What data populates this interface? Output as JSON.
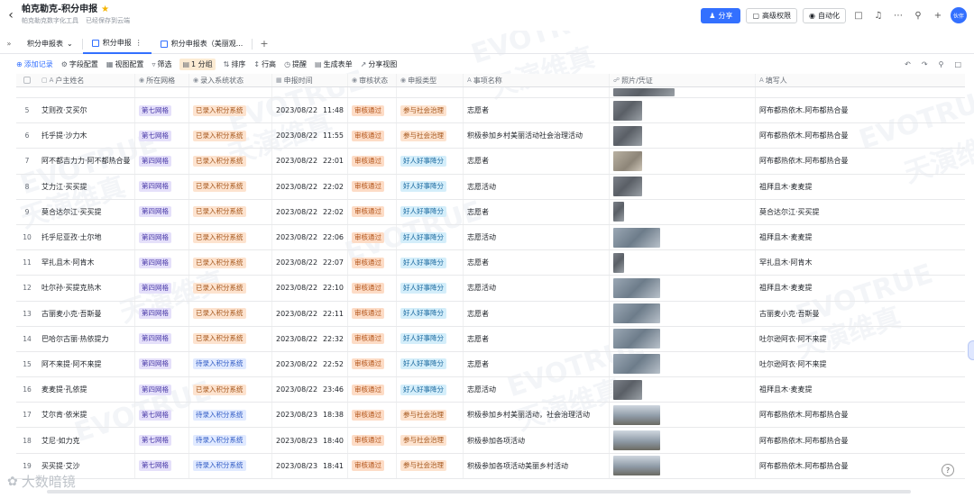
{
  "header": {
    "title": "帕克勒克-积分申报",
    "org": "帕克勒克数字化工具",
    "save_status": "已经保存到云端",
    "share_label": "分享",
    "advanced_perm_label": "高级权限",
    "automation_label": "自动化",
    "avatar_text": "伙伴"
  },
  "tabs": [
    {
      "label": "积分申报表"
    },
    {
      "label": "积分申报"
    },
    {
      "label": "积分申报表（美丽观..."
    }
  ],
  "toolbar": {
    "add_record": "添加记录",
    "field_config": "字段配置",
    "view_config": "视图配置",
    "filter": "筛选",
    "group": "1 分组",
    "sort": "排序",
    "row_height": "行高",
    "remind": "提醒",
    "gen_form": "生成表单",
    "share_view": "分享视图"
  },
  "columns": {
    "name": "户主姓名",
    "grid": "所在网格",
    "sys": "录入系统状态",
    "time": "申报时间",
    "review": "审核状态",
    "type": "申报类型",
    "item": "事项名称",
    "photo": "照片/凭证",
    "filler": "填写人"
  },
  "rows": [
    {
      "idx": "5",
      "name": "艾则孜·艾买尔",
      "grid": "第七网格",
      "sys": "已录入积分系统",
      "date": "2023/08/22",
      "hm": "11:48",
      "review": "审核通过",
      "type": "参与社会治理",
      "item": "志愿者",
      "filler": "阿布都热依木.阿布都热合曼"
    },
    {
      "idx": "6",
      "name": "托乎提·沙力木",
      "grid": "第七网格",
      "sys": "已录入积分系统",
      "date": "2023/08/22",
      "hm": "11:55",
      "review": "审核通过",
      "type": "参与社会治理",
      "item": "积极参加乡村美丽活动社会治理活动",
      "filler": "阿布都热依木.阿布都热合曼"
    },
    {
      "idx": "7",
      "name": "阿不都吉力力·阿不都热合曼",
      "grid": "第四网格",
      "sys": "已录入积分系统",
      "date": "2023/08/22",
      "hm": "22:01",
      "review": "审核通过",
      "type": "好人好事降分",
      "item": "志愿者",
      "filler": "阿布都热依木.阿布都热合曼"
    },
    {
      "idx": "8",
      "name": "艾力江·买买提",
      "grid": "第四网格",
      "sys": "已录入积分系统",
      "date": "2023/08/22",
      "hm": "22:02",
      "review": "审核通过",
      "type": "好人好事降分",
      "item": "志愿活动",
      "filler": "祖拜且木·麦麦提"
    },
    {
      "idx": "9",
      "name": "莫合达尔江·买买提",
      "grid": "第四网格",
      "sys": "已录入积分系统",
      "date": "2023/08/22",
      "hm": "22:02",
      "review": "审核通过",
      "type": "好人好事降分",
      "item": "志愿者",
      "filler": "莫合达尔江·买买提"
    },
    {
      "idx": "10",
      "name": "托乎尼亚孜·土尔地",
      "grid": "第四网格",
      "sys": "已录入积分系统",
      "date": "2023/08/22",
      "hm": "22:06",
      "review": "审核通过",
      "type": "好人好事降分",
      "item": "志愿活动",
      "filler": "祖拜且木·麦麦提"
    },
    {
      "idx": "11",
      "name": "罕扎且木·阿肯木",
      "grid": "第四网格",
      "sys": "已录入积分系统",
      "date": "2023/08/22",
      "hm": "22:07",
      "review": "审核通过",
      "type": "好人好事降分",
      "item": "志愿者",
      "filler": "罕扎且木·阿肯木"
    },
    {
      "idx": "12",
      "name": "吐尔孙·买提克热木",
      "grid": "第四网格",
      "sys": "已录入积分系统",
      "date": "2023/08/22",
      "hm": "22:10",
      "review": "审核通过",
      "type": "好人好事降分",
      "item": "志愿活动",
      "filler": "祖拜且木·麦麦提"
    },
    {
      "idx": "13",
      "name": "古丽麦小克·吾斯曼",
      "grid": "第四网格",
      "sys": "已录入积分系统",
      "date": "2023/08/22",
      "hm": "22:11",
      "review": "审核通过",
      "type": "好人好事降分",
      "item": "志愿者",
      "filler": "古丽麦小克·吾斯曼"
    },
    {
      "idx": "14",
      "name": "巴哈尔古丽·热依提力",
      "grid": "第四网格",
      "sys": "已录入积分系统",
      "date": "2023/08/22",
      "hm": "22:32",
      "review": "审核通过",
      "type": "好人好事降分",
      "item": "志愿者",
      "filler": "吐尔逊阿衣·阿不来提"
    },
    {
      "idx": "15",
      "name": "阿不来提·阿不来提",
      "grid": "第四网格",
      "sys": "待录入积分系统",
      "date": "2023/08/22",
      "hm": "22:52",
      "review": "审核通过",
      "type": "好人好事降分",
      "item": "志愿者",
      "filler": "吐尔逊阿衣·阿不来提"
    },
    {
      "idx": "16",
      "name": "麦麦提·孔依提",
      "grid": "第四网格",
      "sys": "已录入积分系统",
      "date": "2023/08/22",
      "hm": "23:46",
      "review": "审核通过",
      "type": "好人好事降分",
      "item": "志愿活动",
      "filler": "祖拜且木·麦麦提"
    },
    {
      "idx": "17",
      "name": "艾尔肯·依米提",
      "grid": "第七网格",
      "sys": "待录入积分系统",
      "date": "2023/08/23",
      "hm": "18:38",
      "review": "审核通过",
      "type": "参与社会治理",
      "item": "积极参加乡村美丽活动，社会治理活动",
      "filler": "阿布都热依木.阿布都热合曼"
    },
    {
      "idx": "18",
      "name": "艾尼·如力克",
      "grid": "第七网格",
      "sys": "待录入积分系统",
      "date": "2023/08/23",
      "hm": "18:40",
      "review": "审核通过",
      "type": "参与社会治理",
      "item": "积极参加各项活动",
      "filler": "阿布都热依木.阿布都热合曼"
    },
    {
      "idx": "19",
      "name": "买买提·艾沙",
      "grid": "第七网格",
      "sys": "待录入积分系统",
      "date": "2023/08/23",
      "hm": "18:41",
      "review": "审核通过",
      "type": "参与社会治理",
      "item": "积极参加各项活动美丽乡村活动",
      "filler": "阿布都热依木.阿布都热合曼"
    }
  ],
  "watermark": {
    "en": "EVOTRUE",
    "cn": "天演维真"
  },
  "bottom_logo": "大数暗镜",
  "colors": {
    "accent": "#3370ff",
    "grid_tag": "#e5e0fa",
    "sys_in_tag": "#fde3cf",
    "sys_wait_tag": "#e1eaff",
    "review_tag": "#fddcc6",
    "good_tag": "#d4eefa"
  }
}
